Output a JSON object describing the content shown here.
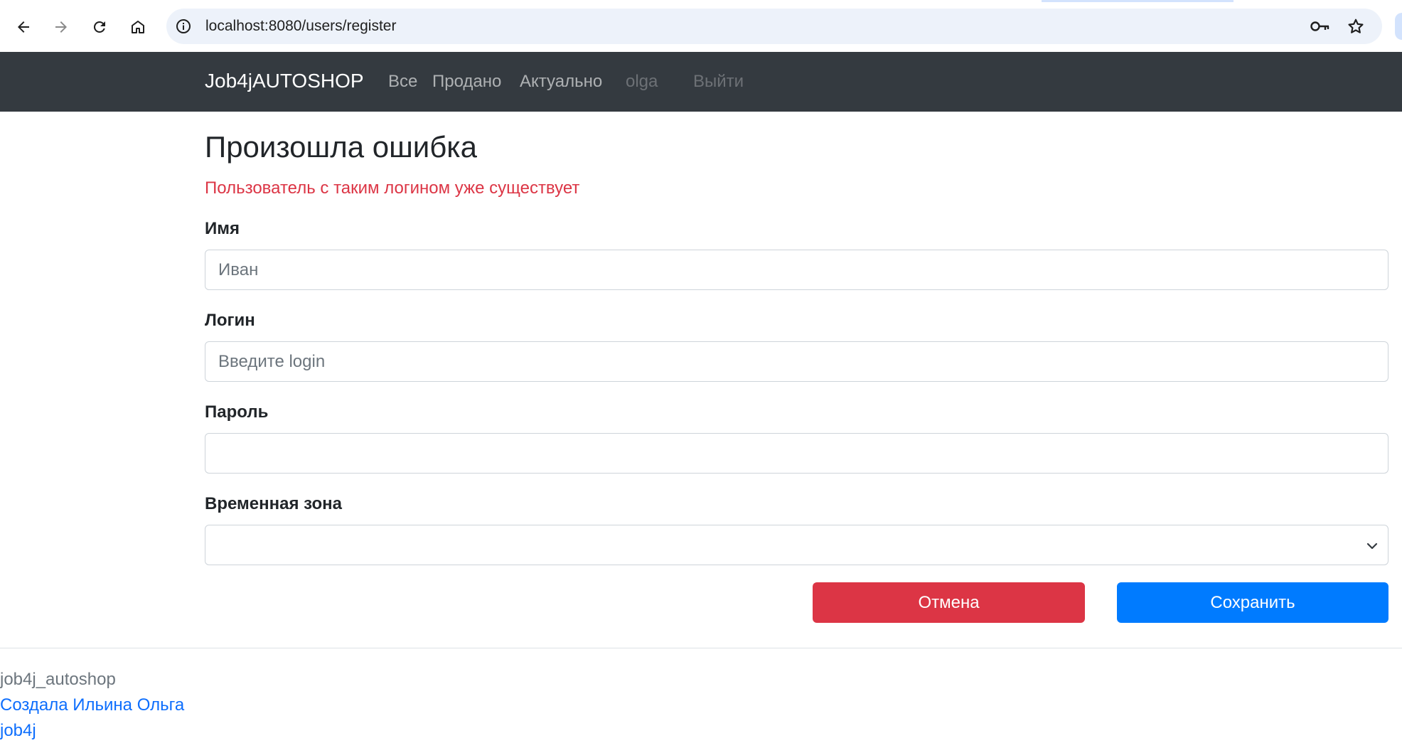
{
  "browser": {
    "url": "localhost:8080/users/register",
    "icons": [
      "back-arrow-icon",
      "forward-arrow-icon",
      "reload-icon",
      "home-icon",
      "site-info-icon",
      "password-key-icon",
      "bookmark-star-icon"
    ]
  },
  "navbar": {
    "brand": "Job4jAUTOSHOP",
    "links": [
      {
        "label": "Все"
      },
      {
        "label": "Продано"
      },
      {
        "label": "Актуально"
      },
      {
        "label": "olga"
      },
      {
        "label": "Выйти"
      }
    ],
    "background": "#343a40"
  },
  "main": {
    "title": "Произошла ошибка",
    "error_message": "Пользователь с таким логином уже существует",
    "error_color": "#dc3545",
    "form": {
      "name": {
        "label": "Имя",
        "placeholder": "Иван",
        "value": ""
      },
      "login": {
        "label": "Логин",
        "placeholder": "Введите login",
        "value": ""
      },
      "password": {
        "label": "Пароль",
        "placeholder": "",
        "value": ""
      },
      "timezone": {
        "label": "Временная зона",
        "selected": ""
      }
    },
    "buttons": {
      "cancel": {
        "label": "Отмена",
        "color": "#dc3545"
      },
      "save": {
        "label": "Сохранить",
        "color": "#007bff"
      }
    }
  },
  "footer": {
    "project": "job4j_autoshop",
    "author_link": "Создала Ильина Ольга",
    "org_link": "job4j"
  }
}
